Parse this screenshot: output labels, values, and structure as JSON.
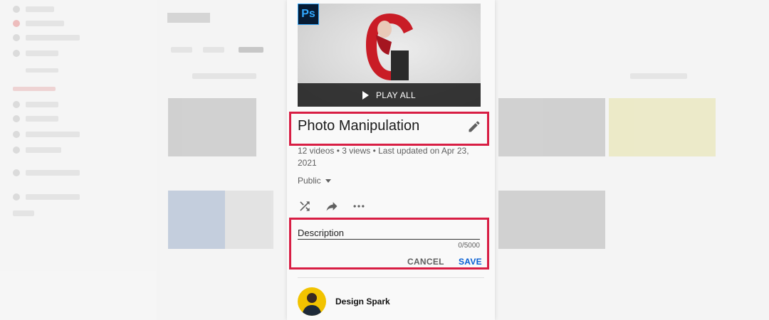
{
  "playlist": {
    "thumbnail_badge": "Ps",
    "play_all_label": "PLAY ALL",
    "title": "Photo Manipulation",
    "meta": "12 videos • 3 views • Last updated on Apr 23, 2021",
    "privacy": "Public",
    "description_label": "Description",
    "description_counter": "0/5000",
    "cancel_label": "CANCEL",
    "save_label": "SAVE",
    "owner_name": "Design Spark"
  },
  "icons": {
    "edit": "pencil-icon",
    "shuffle": "shuffle-icon",
    "share": "share-icon",
    "more": "more-horizontal-icon",
    "play": "play-icon",
    "privacy_dropdown": "caret-down-icon"
  },
  "colors": {
    "highlight": "#d81e44",
    "save_blue": "#065fd4",
    "photoshop_blue": "#31a8ff",
    "avatar_bg": "#f2c300"
  }
}
